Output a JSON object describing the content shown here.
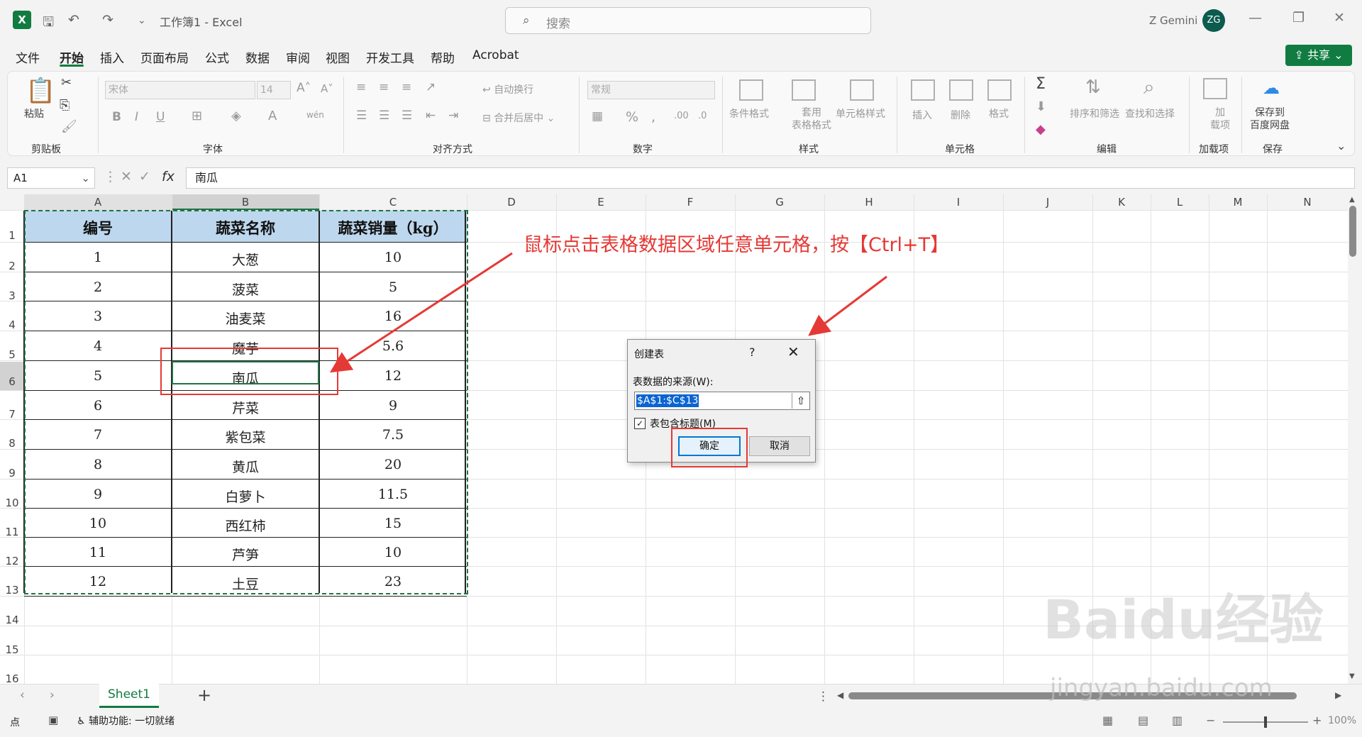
{
  "titlebar": {
    "logo": "X",
    "title": "工作簿1  -  Excel",
    "search_placeholder": "搜索",
    "user": "Z Gemini",
    "avatar": "ZG"
  },
  "menu": {
    "tabs": [
      "文件",
      "开始",
      "插入",
      "页面布局",
      "公式",
      "数据",
      "审阅",
      "视图",
      "开发工具",
      "帮助",
      "Acrobat"
    ],
    "share": "共享"
  },
  "ribbon": {
    "clipboard": {
      "paste": "粘贴",
      "label": "剪贴板"
    },
    "font": {
      "name": "宋体",
      "size": "14",
      "label": "字体"
    },
    "align": {
      "wrap": "自动换行",
      "merge": "合并后居中",
      "label": "对齐方式"
    },
    "number": {
      "format": "常规",
      "label": "数字"
    },
    "styles": {
      "conditional": "条件格式",
      "table_format": "套用\n表格格式",
      "cell_styles": "单元格样式",
      "label": "样式"
    },
    "cells": {
      "insert": "插入",
      "delete": "删除",
      "format": "格式",
      "label": "单元格"
    },
    "editing": {
      "sort": "排序和筛选",
      "find": "查找和选择",
      "label": "编辑"
    },
    "addins": {
      "btn": "加\n载项",
      "label": "加载项"
    },
    "save": {
      "btn": "保存到\n百度网盘",
      "label": "保存"
    }
  },
  "formula_bar": {
    "name_box": "A1",
    "fx": "fx",
    "content": "南瓜"
  },
  "grid": {
    "columns": [
      "A",
      "B",
      "C",
      "D",
      "E",
      "F",
      "G",
      "H",
      "I",
      "J",
      "K",
      "L",
      "M",
      "N"
    ],
    "rows": [
      "1",
      "2",
      "3",
      "4",
      "5",
      "6",
      "7",
      "8",
      "9",
      "10",
      "11",
      "12",
      "13",
      "14",
      "15",
      "16"
    ],
    "headers": [
      "编号",
      "蔬菜名称",
      "蔬菜销量（kg）"
    ],
    "data": [
      [
        "1",
        "大葱",
        "10"
      ],
      [
        "2",
        "菠菜",
        "5"
      ],
      [
        "3",
        "油麦菜",
        "16"
      ],
      [
        "4",
        "魔芋",
        "5.6"
      ],
      [
        "5",
        "南瓜",
        "12"
      ],
      [
        "6",
        "芹菜",
        "9"
      ],
      [
        "7",
        "紫包菜",
        "7.5"
      ],
      [
        "8",
        "黄瓜",
        "20"
      ],
      [
        "9",
        "白萝卜",
        "11.5"
      ],
      [
        "10",
        "西红柿",
        "15"
      ],
      [
        "11",
        "芦笋",
        "10"
      ],
      [
        "12",
        "土豆",
        "23"
      ]
    ]
  },
  "annotation": {
    "text": "鼠标点击表格数据区域任意单元格，按【Ctrl+T】",
    "color": "#e53935"
  },
  "dialog": {
    "title": "创建表",
    "help": "?",
    "close": "✕",
    "source_label": "表数据的来源(W):",
    "range": "$A$1:$C$13",
    "has_headers_label": "表包含标题(M)",
    "has_headers_checked": true,
    "ok": "确定",
    "cancel": "取消"
  },
  "sheets": {
    "tab": "Sheet1",
    "add": "+"
  },
  "status": {
    "mode": "点",
    "accessibility": "辅助功能: 一切就绪",
    "zoom": "100%"
  },
  "watermark": {
    "brand": "Baidu经验",
    "url": "jingyan.baidu.com"
  },
  "colors": {
    "excel_green": "#107c41",
    "header_fill": "#bdd7ee",
    "annotation_red": "#e53935"
  }
}
